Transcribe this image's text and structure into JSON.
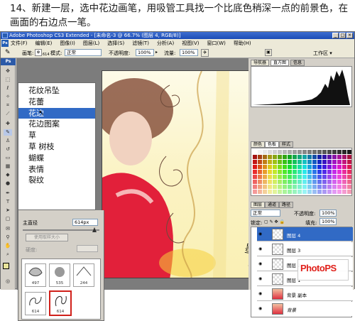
{
  "instruction": "14、新建一层，选中花边画笔，用吸管工具找一个比底色稍深一点的前景色，在画面的右边点一笔。",
  "window": {
    "title": "Adobe Photoshop CS3 Extended - [未命名-3 @ 66.7% (图层 4, RGB/8)]",
    "controls": [
      "_",
      "□",
      "×"
    ]
  },
  "menu": [
    "文件(F)",
    "编辑(E)",
    "图像(I)",
    "图层(L)",
    "选择(S)",
    "滤镜(T)",
    "分析(A)",
    "视图(V)",
    "窗口(W)",
    "帮助(H)"
  ],
  "options": {
    "brush_label": "画笔:",
    "brush_size": "614",
    "mode_label": "模式:",
    "mode_value": "正常",
    "opacity_label": "不透明度:",
    "opacity_value": "100%",
    "flow_label": "流量:",
    "flow_value": "100%",
    "workspace": "工作区 ▾"
  },
  "brush_menu": {
    "items": [
      "花纹吊坠",
      "花蕾",
      "花边",
      "花边图案",
      "草",
      "草 树枝",
      "蝴蝶",
      "表情",
      "裂纹"
    ],
    "selected_index": 2
  },
  "brush_panel": {
    "diameter_label": "主直径",
    "diameter_value": "614px",
    "sample_button": "使用取样大小",
    "hardness_label": "硬度:",
    "thumbs": [
      {
        "num": "497"
      },
      {
        "num": "535"
      },
      {
        "num": "244"
      },
      {
        "num": "614"
      },
      {
        "num": "614"
      }
    ]
  },
  "panels": {
    "navigator_tabs": [
      "导航器",
      "直方图",
      "信息"
    ],
    "color_tabs": [
      "颜色",
      "色板",
      "样式"
    ],
    "layers_tabs": [
      "图层",
      "通道",
      "路径"
    ],
    "blend_mode": "正常",
    "opacity_label": "不透明度:",
    "opacity_value": "100%",
    "lock_label": "锁定:",
    "fill_label": "填充:",
    "fill_value": "100%",
    "layers": [
      {
        "name": "图层 4",
        "selected": true
      },
      {
        "name": "图层 3",
        "selected": false
      },
      {
        "name": "图层 2",
        "selected": false
      },
      {
        "name": "图层 1",
        "selected": false
      },
      {
        "name": "背景 副本",
        "selected": false
      },
      {
        "name": "背景",
        "selected": false
      }
    ]
  },
  "watermark": "PhotoPS",
  "colors": {
    "accent": "#316ac5",
    "title_bar": "#2a5fc4",
    "highlight_frame": "#d0201a"
  }
}
